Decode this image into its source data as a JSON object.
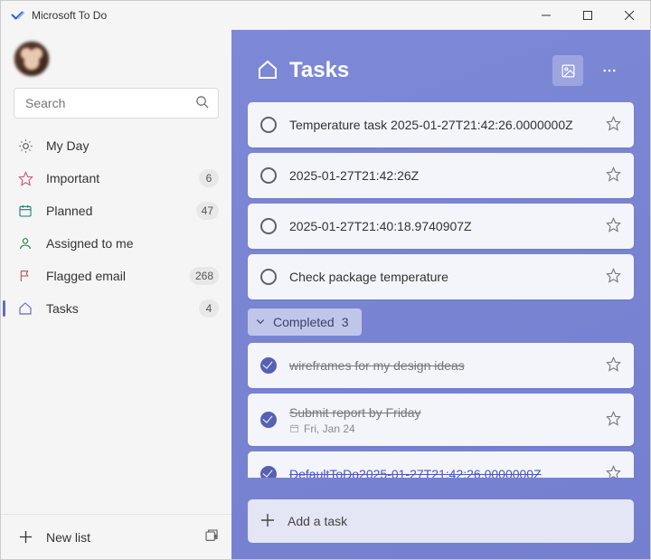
{
  "window": {
    "title": "Microsoft To Do",
    "minimize": "–",
    "maximize": "☐",
    "close": "✕"
  },
  "sidebar": {
    "search_placeholder": "Search",
    "items": [
      {
        "id": "myday",
        "label": "My Day",
        "icon": "sun",
        "count": null
      },
      {
        "id": "important",
        "label": "Important",
        "icon": "star",
        "count": "6"
      },
      {
        "id": "planned",
        "label": "Planned",
        "icon": "calendar",
        "count": "47"
      },
      {
        "id": "assigned",
        "label": "Assigned to me",
        "icon": "person",
        "count": null
      },
      {
        "id": "flagged",
        "label": "Flagged email",
        "icon": "flag",
        "count": "268"
      },
      {
        "id": "tasks",
        "label": "Tasks",
        "icon": "home",
        "count": "4",
        "active": true
      }
    ],
    "new_list_label": "New list"
  },
  "main": {
    "title": "Tasks",
    "completed_label": "Completed",
    "completed_count": "3",
    "add_task_label": "Add a task",
    "tasks": [
      {
        "title": "Temperature task 2025-01-27T21:42:26.0000000Z",
        "completed": false
      },
      {
        "title": "2025-01-27T21:42:26Z",
        "completed": false
      },
      {
        "title": "2025-01-27T21:40:18.9740907Z",
        "completed": false
      },
      {
        "title": "Check package temperature",
        "completed": false
      }
    ],
    "completed_tasks": [
      {
        "title": "wireframes for my design ideas",
        "completed": true,
        "highlight": false
      },
      {
        "title": "Submit report by Friday",
        "completed": true,
        "due": "Fri, Jan 24",
        "highlight": false
      },
      {
        "title": "DefaultToDo2025-01-27T21:42:26.0000000Z",
        "completed": true,
        "highlight": true
      }
    ]
  }
}
